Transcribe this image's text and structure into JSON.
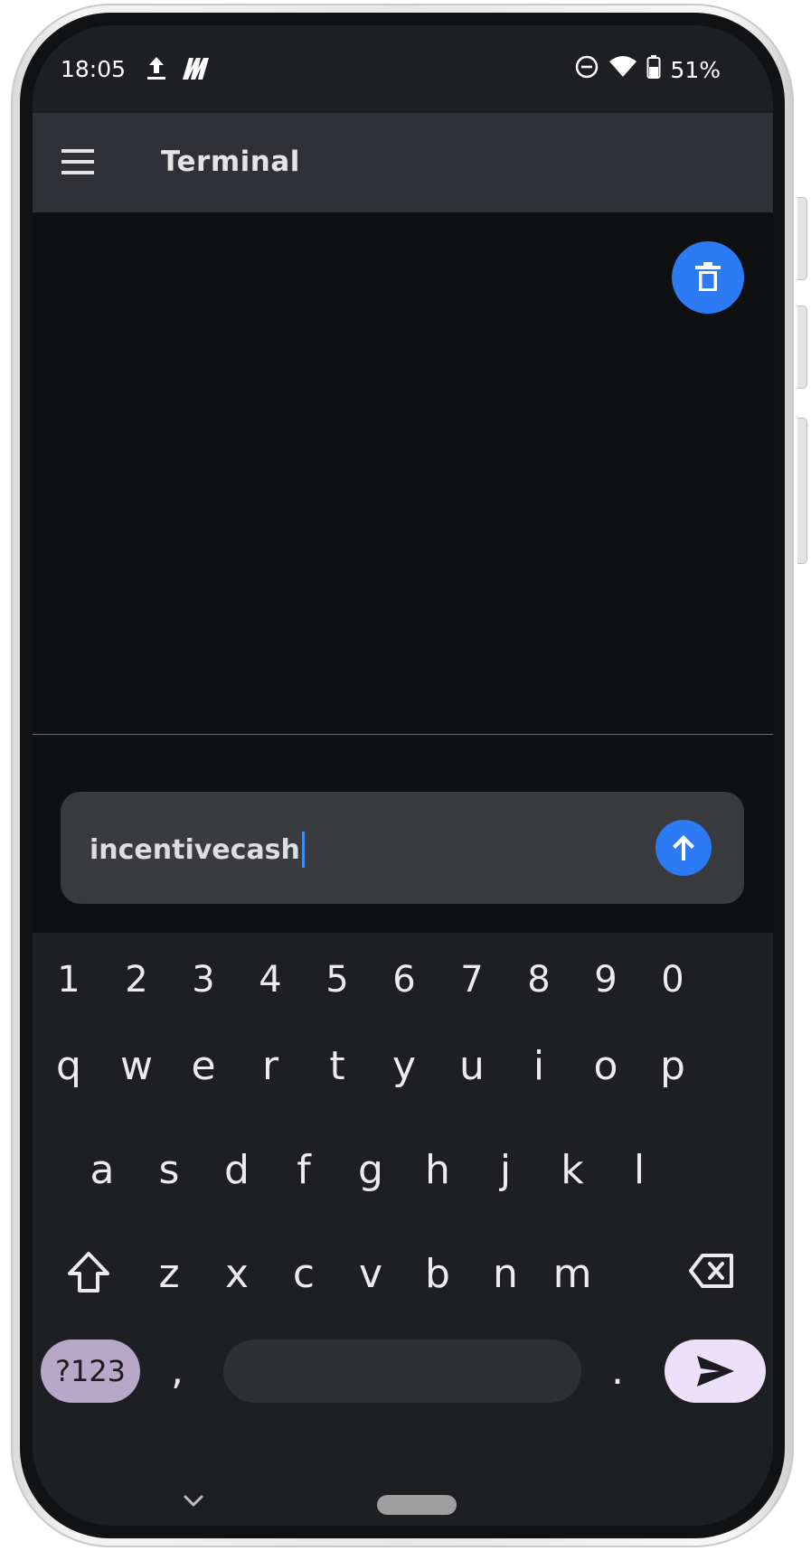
{
  "status_bar": {
    "time": "18:05",
    "battery": "51%",
    "icons": [
      "upload-icon",
      "app-notification-icon",
      "dnd-icon",
      "wifi-icon",
      "battery-icon"
    ]
  },
  "app_bar": {
    "title": "Terminal"
  },
  "terminal": {
    "output": ""
  },
  "input": {
    "value": "incentivecash"
  },
  "colors": {
    "accent": "#2d7bf4",
    "terminal_bg": "#0f1012",
    "app_bar_bg": "#2f3136",
    "keyboard_bg": "#1e1f22",
    "sym_key": "#b6a8c6",
    "enter_key": "#ece0fa"
  },
  "keyboard": {
    "number_row": [
      "1",
      "2",
      "3",
      "4",
      "5",
      "6",
      "7",
      "8",
      "9",
      "0"
    ],
    "row1": [
      "q",
      "w",
      "e",
      "r",
      "t",
      "y",
      "u",
      "i",
      "o",
      "p"
    ],
    "row2": [
      "a",
      "s",
      "d",
      "f",
      "g",
      "h",
      "j",
      "k",
      "l"
    ],
    "row3": [
      "z",
      "x",
      "c",
      "v",
      "b",
      "n",
      "m"
    ],
    "symbols_label": "?123",
    "comma": ",",
    "period": "."
  }
}
